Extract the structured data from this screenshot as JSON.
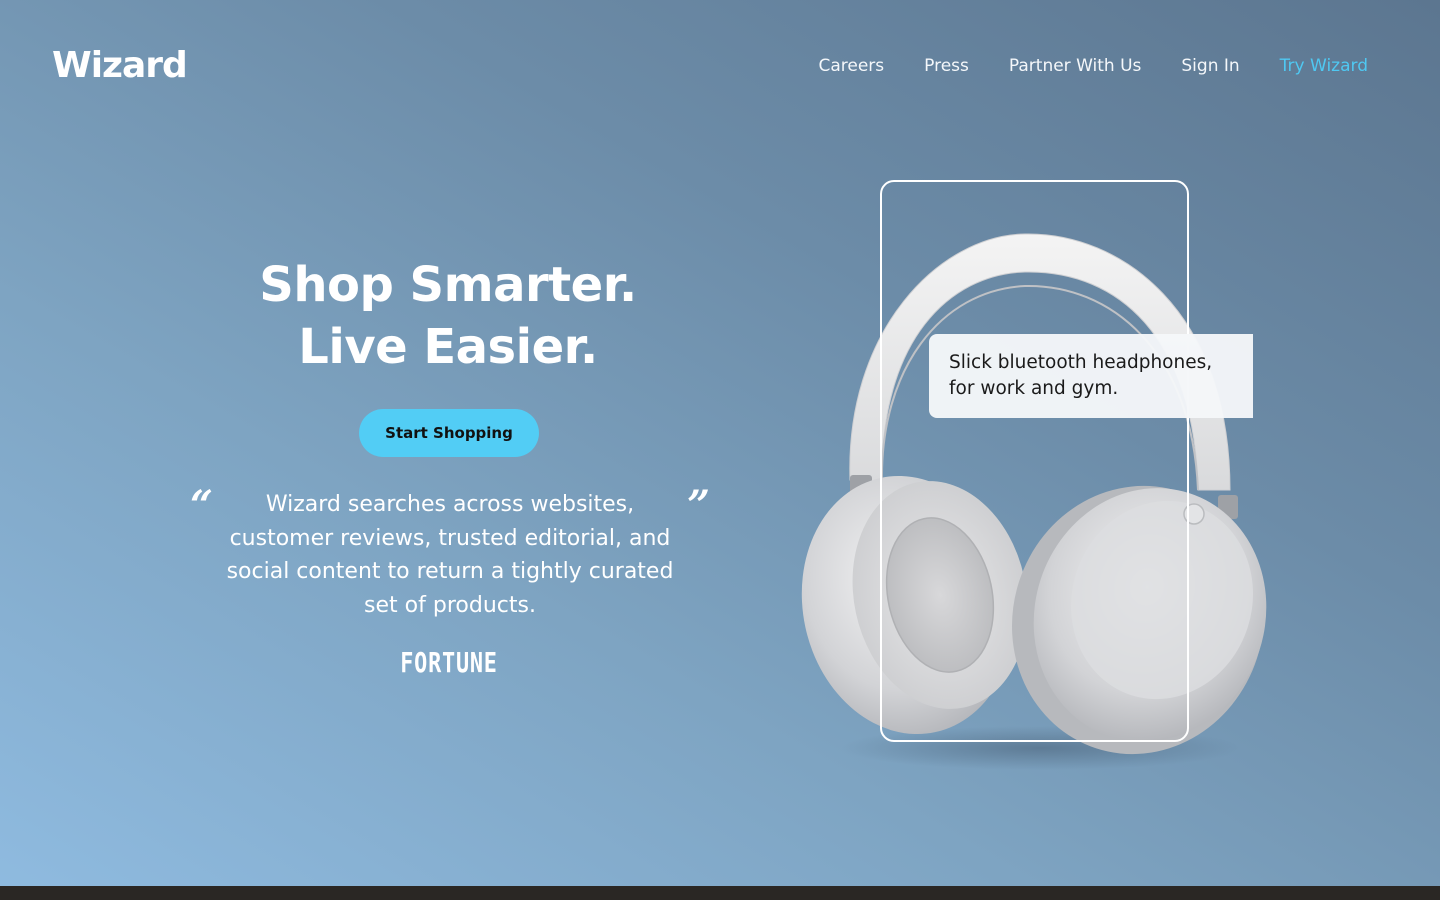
{
  "header": {
    "logo": "Wizard",
    "nav": [
      {
        "label": "Careers"
      },
      {
        "label": "Press"
      },
      {
        "label": "Partner With Us"
      },
      {
        "label": "Sign In"
      },
      {
        "label": "Try Wizard"
      }
    ]
  },
  "hero": {
    "headline_line1": "Shop Smarter.",
    "headline_line2": "Live Easier.",
    "cta_label": "Start Shopping",
    "quote_open": "“",
    "quote_close": "”",
    "quote_text": "Wizard searches across websites, customer reviews, trusted editorial, and social content to return a tightly curated set of products.",
    "quote_source": "FORTUNE"
  },
  "product_card": {
    "caption": "Slick bluetooth headphones, for work and gym."
  },
  "colors": {
    "accent": "#4fc8f2",
    "cta_background": "#52cdf5",
    "footer_strip": "#2a2724"
  }
}
